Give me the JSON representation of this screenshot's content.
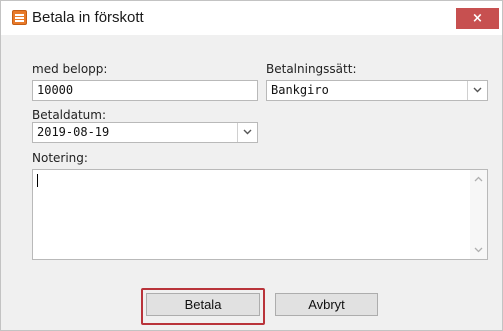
{
  "window": {
    "title": "Betala in förskott",
    "close_label": "×"
  },
  "form": {
    "amount_label": "med belopp:",
    "amount_value": "10000",
    "payment_method_label": "Betalningssätt:",
    "payment_method_value": "Bankgiro",
    "pay_date_label": "Betaldatum:",
    "pay_date_value": "2019-08-19",
    "note_label": "Notering:",
    "note_value": ""
  },
  "buttons": {
    "pay_label": "Betala",
    "cancel_label": "Avbryt"
  },
  "colors": {
    "close_button": "#c75050",
    "focus_ring": "#b9333a",
    "app_icon": "#e87a2a"
  },
  "icons": {
    "app": "app-form-icon",
    "close": "close-icon",
    "dropdown": "chevron-down-icon"
  }
}
